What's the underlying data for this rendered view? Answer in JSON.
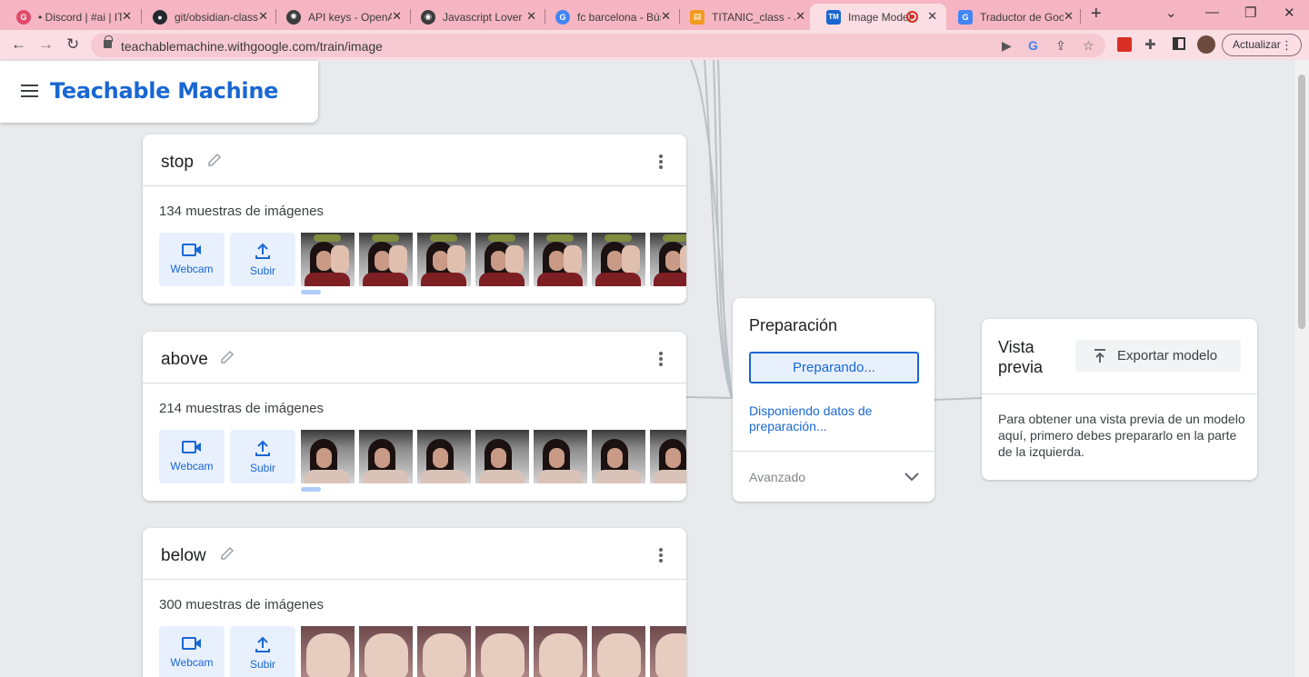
{
  "browser": {
    "tabs": [
      {
        "title": "• Discord | #ai | IT",
        "fav_color": "#e04b6a",
        "fav_glyph": "G"
      },
      {
        "title": "git/obsidian-class",
        "fav_color": "#24292f",
        "fav_glyph": "●"
      },
      {
        "title": "API keys - OpenAI",
        "fav_color": "#3c3c3c",
        "fav_glyph": "✺"
      },
      {
        "title": "Javascript Lover",
        "fav_color": "#3c3c3c",
        "fav_glyph": "◉"
      },
      {
        "title": "fc barcelona - Bús",
        "fav_color": "#4285f4",
        "fav_glyph": "G"
      },
      {
        "title": "TITANIC_class - Ju",
        "fav_color": "#f29b1d",
        "fav_glyph": "▤"
      },
      {
        "title": "Image Model",
        "fav_color": "#1967d2",
        "fav_glyph": "TM"
      },
      {
        "title": "Traductor de Goo",
        "fav_color": "#4285f4",
        "fav_glyph": "G"
      }
    ],
    "url": "teachablemachine.withgoogle.com/train/image",
    "update_label": "Actualizar"
  },
  "app": {
    "title": "Teachable Machine",
    "brand_color": "#1967d2"
  },
  "classes": [
    {
      "name": "stop",
      "samples": "134 muestras de imágenes",
      "thumb_kind": "hand-raised"
    },
    {
      "name": "above",
      "samples": "214 muestras de imágenes",
      "thumb_kind": "face-hand"
    },
    {
      "name": "below",
      "samples": "300 muestras de imágenes",
      "thumb_kind": "hand-down"
    }
  ],
  "class_buttons": {
    "webcam": "Webcam",
    "upload": "Subir"
  },
  "training": {
    "title": "Preparación",
    "button_label": "Preparando...",
    "status": "Disponiendo datos de preparación...",
    "advanced_label": "Avanzado"
  },
  "preview": {
    "title": "Vista previa",
    "export_label": "Exportar modelo",
    "message": "Para obtener una vista previa de un modelo aquí, primero debes prepararlo en la parte de la izquierda."
  }
}
